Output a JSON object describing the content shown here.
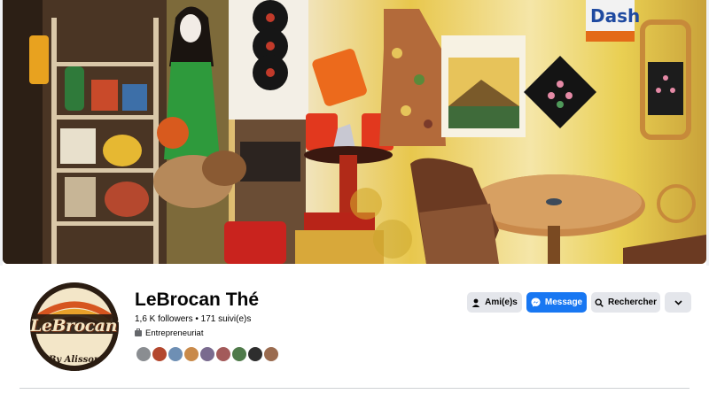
{
  "page": {
    "name": "LeBrocan Thé",
    "stats": "1,6 K followers • 171 suivi(e)s",
    "category": "Entrepreneuriat"
  },
  "avatar": {
    "line1": "LeBrocanThé",
    "line2": "By Alisson",
    "line3": "NCEPT ST"
  },
  "cover": {
    "sign_text": "Dash"
  },
  "actions": {
    "friends_label": "Ami(e)s",
    "message_label": "Message",
    "search_label": "Rechercher"
  },
  "friends_preview": {
    "colors": [
      "#8a8d91",
      "#b3472e",
      "#6e8fb4",
      "#c98a4a",
      "#7a6b8f",
      "#a35a5a",
      "#4f7a4a",
      "#2e2e2e",
      "#9a6b4f"
    ]
  },
  "colors": {
    "accent": "#1877f2",
    "secondary_button": "#e4e6eb",
    "text": "#050505"
  }
}
